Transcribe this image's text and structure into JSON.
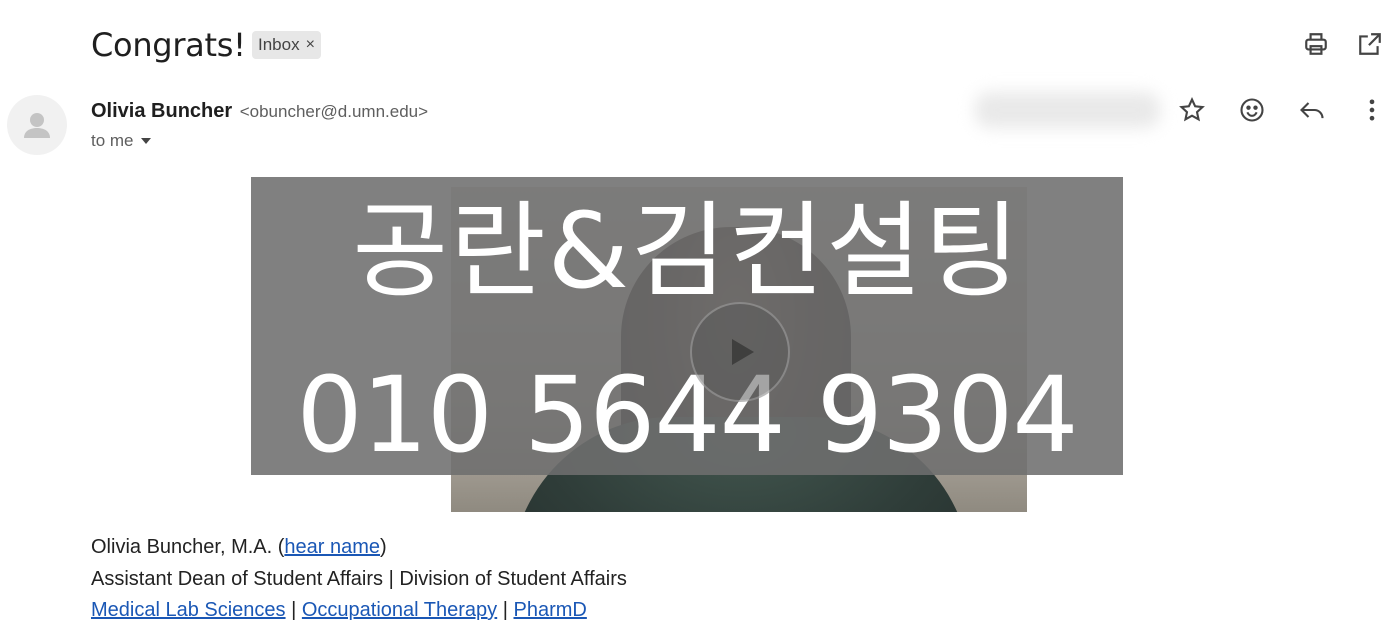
{
  "subject": "Congrats!",
  "label": {
    "text": "Inbox",
    "remove": "×"
  },
  "header_icons": [
    "print-icon",
    "open-in-new-window-icon"
  ],
  "sender": {
    "name": "Olivia Buncher",
    "email": "<obuncher@d.umn.edu>"
  },
  "recipient": {
    "text": "to me"
  },
  "message_icons": [
    "star-icon",
    "emoji-reaction-icon",
    "reply-icon",
    "more-vert-icon"
  ],
  "body_image": {
    "overlay_line1": "공란&김컨설팅",
    "overlay_line2": "010 5644 9304"
  },
  "signature": {
    "line1_prefix": "Olivia Buncher, M.A. (",
    "line1_link": "hear name",
    "line1_suffix": ")",
    "line2": "Assistant Dean of Student Affairs | Division of Student Affairs",
    "links": [
      "Medical Lab Sciences",
      "Occupational Therapy",
      "PharmD"
    ],
    "separator": " | "
  },
  "colors": {
    "link": "#1a57b5",
    "chip_bg": "#e7e7e7",
    "overlay": "#6e6e6e"
  }
}
